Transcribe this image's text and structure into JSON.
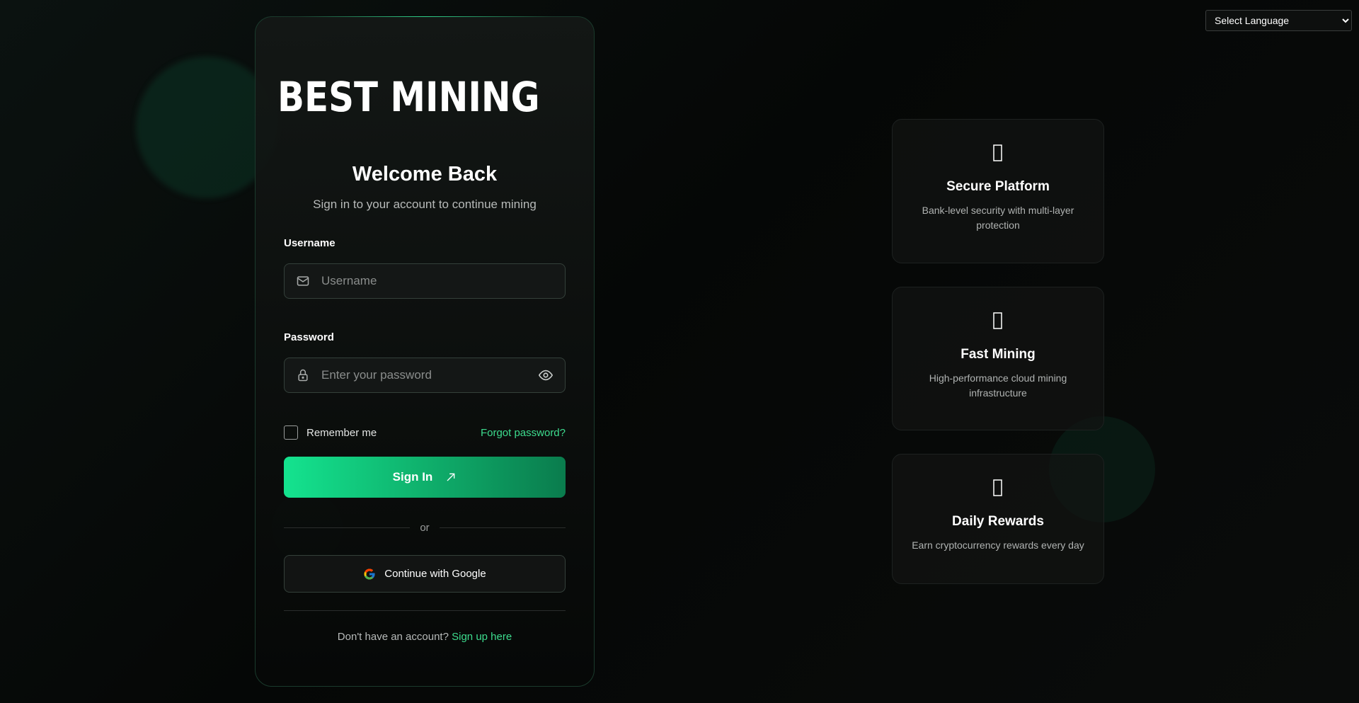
{
  "language": {
    "selected": "Select Language"
  },
  "brand": {
    "name": "BEST MINING",
    "logo_icon": "best-mining-b-logo",
    "accent_color": "#14e38f"
  },
  "login": {
    "title": "Welcome Back",
    "subtitle": "Sign in to your account to continue mining",
    "username_label": "Username",
    "username_placeholder": "Username",
    "username_icon": "mail-icon",
    "password_label": "Password",
    "password_placeholder": "Enter your password",
    "password_icon": "lock-icon",
    "show_password_icon": "eye-icon",
    "remember_label": "Remember me",
    "forgot_label": "Forgot password?",
    "signin_label": "Sign In",
    "signin_icon": "arrow-up-right-icon",
    "divider_label": "or",
    "google_label": "Continue with Google",
    "google_icon": "google-icon",
    "signup_prompt": "Don't have an account?",
    "signup_link": "Sign up here"
  },
  "features": [
    {
      "icon": "shield-icon",
      "title": "Secure Platform",
      "description": "Bank-level security with multi-layer protection"
    },
    {
      "icon": "bolt-icon",
      "title": "Fast Mining",
      "description": "High-performance cloud mining infrastructure"
    },
    {
      "icon": "coins-icon",
      "title": "Daily Rewards",
      "description": "Earn cryptocurrency rewards every day"
    }
  ]
}
